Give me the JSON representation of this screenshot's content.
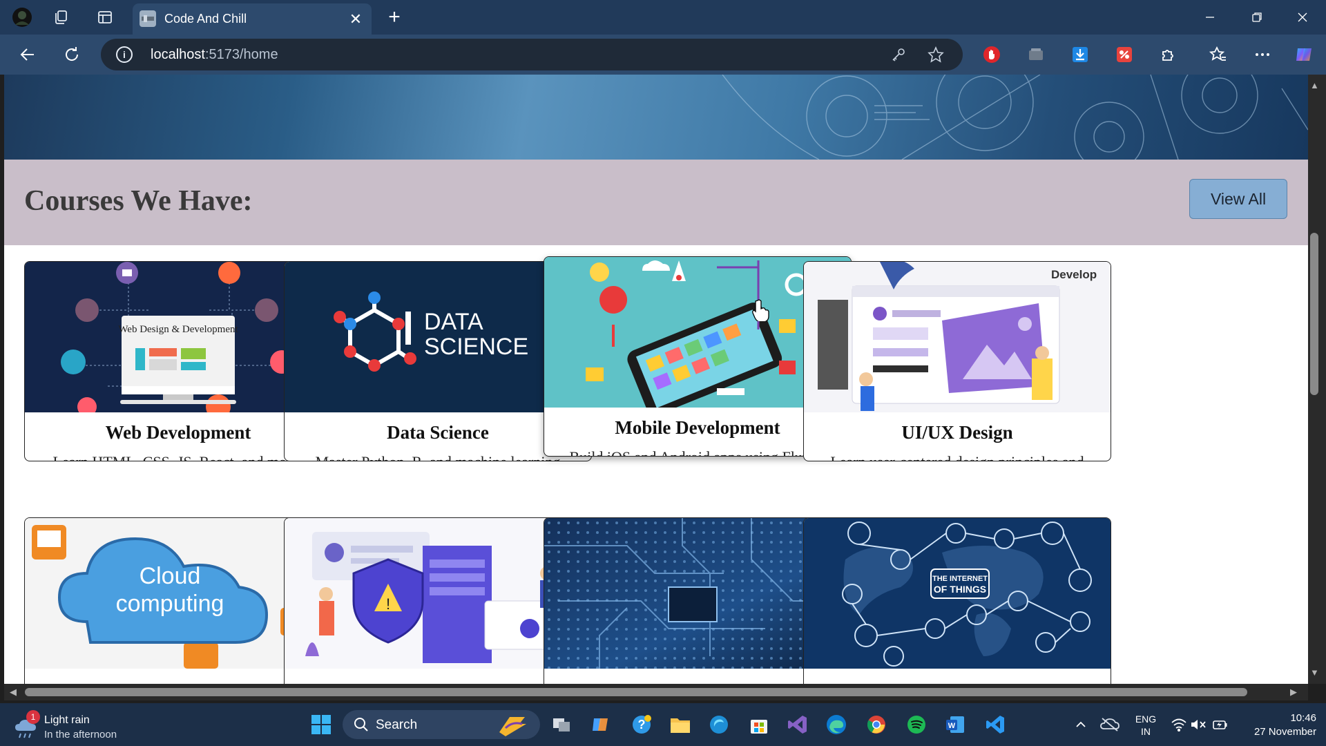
{
  "browser": {
    "tab_title": "Code And Chill",
    "url_host": "localhost",
    "url_rest": ":5173/home"
  },
  "page": {
    "section_title": "Courses We Have:",
    "view_all_label": "View All",
    "cards": [
      {
        "title": "Web Development",
        "desc": "Learn HTML, CSS, JS, React, and more!",
        "image_text": "Web Design & Development"
      },
      {
        "title": "Data Science",
        "desc": "Master Python, R, and machine learning techniques.",
        "image_text_1": "DATA",
        "image_text_2": "SCIENCE"
      },
      {
        "title": "Mobile Development",
        "desc": "Build iOS and Android apps using Flutter."
      },
      {
        "title": "UI/UX Design",
        "desc": "Learn user-centered design principles and tools.",
        "image_text": "Develop"
      },
      {
        "image_text_1": "Cloud",
        "image_text_2": "computing"
      },
      {},
      {},
      {
        "image_text_1": "THE INTERNET",
        "image_text_2": "OF THINGS"
      }
    ]
  },
  "taskbar": {
    "weather_badge": "1",
    "weather_line1": "Light rain",
    "weather_line2": "In the afternoon",
    "search_label": "Search",
    "lang_line1": "ENG",
    "lang_line2": "IN",
    "time": "10:46",
    "date": "27 November"
  },
  "colors": {
    "titlebar": "#213a5a",
    "toolbar": "#2d4a6d",
    "heading_band": "#c9bec9",
    "view_all_button": "#86aed4",
    "taskbar": "#1c2f48"
  }
}
